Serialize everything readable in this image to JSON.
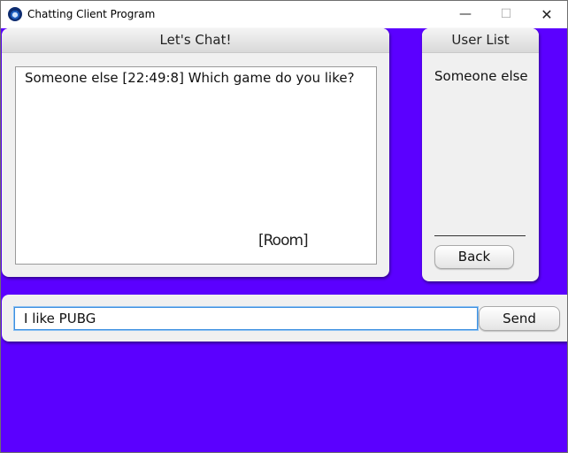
{
  "window": {
    "title": "Chatting Client Program",
    "controls": {
      "minimize": "—",
      "maximize": "☐",
      "close": "✕"
    }
  },
  "chat_panel": {
    "title": "Let's Chat!",
    "messages": [
      "Someone else [22:49:8] Which game do you like?"
    ],
    "room_label": "[Room]"
  },
  "user_panel": {
    "title": "User List",
    "users": [
      "Someone else"
    ],
    "back_label": "Back"
  },
  "input_bar": {
    "message_value": "I like PUBG",
    "send_label": "Send"
  },
  "colors": {
    "background": "#5b00ff",
    "panel": "#f0f0f0",
    "input_focus": "#3c8fe0"
  }
}
